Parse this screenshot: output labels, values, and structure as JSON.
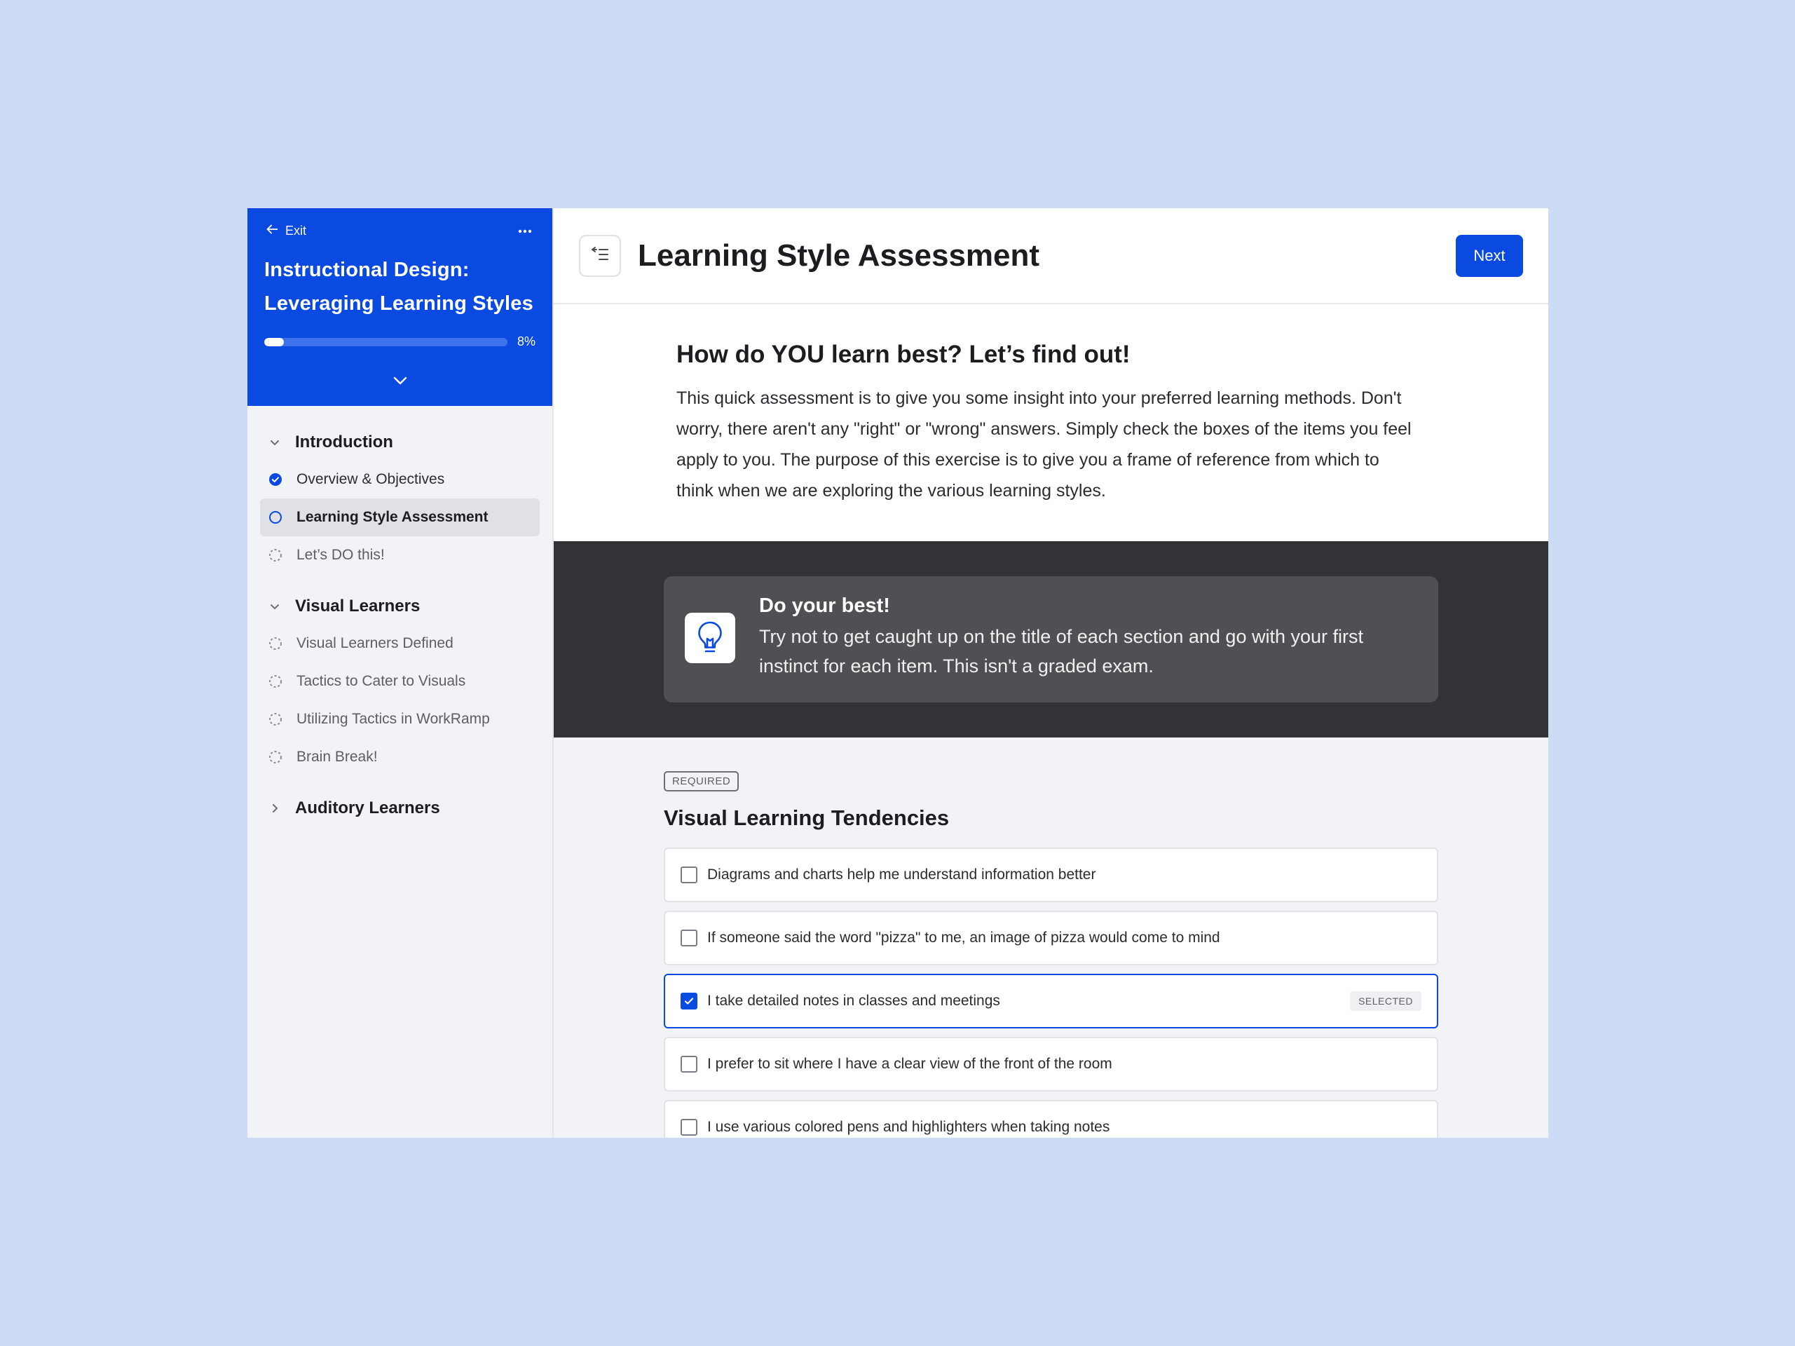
{
  "colors": {
    "brand": "#0a4ae0",
    "page_bg": "#cddbf6",
    "dark_band": "#323336"
  },
  "sidebar": {
    "exit_label": "Exit",
    "more_icon": "more-horizontal-icon",
    "course_title_line1": "Instructional Design:",
    "course_title_line2": "Leveraging Learning Styles",
    "progress_percent": 8,
    "progress_label": "8%",
    "sections": [
      {
        "title": "Introduction",
        "expanded": true,
        "lessons": [
          {
            "label": "Overview & Objectives",
            "status": "complete"
          },
          {
            "label": "Learning Style Assessment",
            "status": "current"
          },
          {
            "label": "Let’s DO this!",
            "status": "not-started"
          }
        ]
      },
      {
        "title": "Visual Learners",
        "expanded": true,
        "lessons": [
          {
            "label": "Visual Learners Defined",
            "status": "not-started"
          },
          {
            "label": "Tactics to Cater to Visuals",
            "status": "not-started"
          },
          {
            "label": "Utilizing Tactics in WorkRamp",
            "status": "not-started"
          },
          {
            "label": "Brain Break!",
            "status": "not-started"
          }
        ]
      },
      {
        "title": "Auditory Learners",
        "expanded": false,
        "lessons": []
      }
    ]
  },
  "header": {
    "title": "Learning Style Assessment",
    "next_label": "Next"
  },
  "intro": {
    "heading": "How do YOU learn best? Let’s find out!",
    "body": "This quick assessment is to give you some insight into your preferred learning methods. Don't worry, there aren't any \"right\" or \"wrong\" answers.  Simply check the boxes of the items you feel apply to you.  The purpose of this exercise is to give you a frame of reference from which to think when we are exploring the various learning styles."
  },
  "callout": {
    "icon": "lightbulb-icon",
    "title": "Do your best!",
    "body": "Try not to get caught up on the title of each section and go with your first instinct for each item.  This isn't a graded exam."
  },
  "question": {
    "required_label": "REQUIRED",
    "title": "Visual Learning Tendencies",
    "selected_badge": "SELECTED",
    "options": [
      {
        "label": "Diagrams and charts help me understand information better",
        "checked": false
      },
      {
        "label": "If someone said the word \"pizza\" to me, an image of pizza would come to mind",
        "checked": false
      },
      {
        "label": "I take detailed notes in classes and meetings",
        "checked": true
      },
      {
        "label": "I prefer to sit where I have a clear view of the front of the room",
        "checked": false
      },
      {
        "label": "I use various colored pens and highlighters when taking notes",
        "checked": false
      }
    ]
  }
}
